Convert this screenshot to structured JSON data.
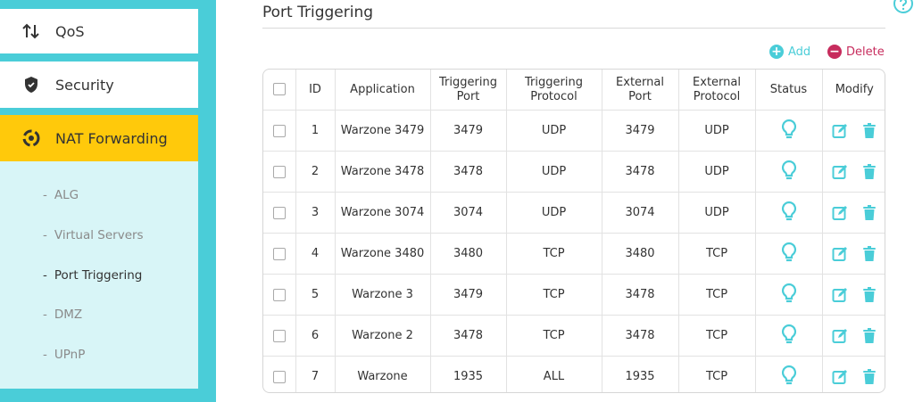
{
  "sidebar": {
    "items": [
      {
        "label": "QoS",
        "icon": "sort-arrows-icon"
      },
      {
        "label": "Security",
        "icon": "shield-icon"
      },
      {
        "label": "NAT Forwarding",
        "icon": "nat-icon"
      }
    ],
    "submenu": [
      {
        "label": "ALG",
        "active": false
      },
      {
        "label": "Virtual Servers",
        "active": false
      },
      {
        "label": "Port Triggering",
        "active": true
      },
      {
        "label": "DMZ",
        "active": false
      },
      {
        "label": "UPnP",
        "active": false
      }
    ],
    "dash": "-"
  },
  "page": {
    "title": "Port Triggering"
  },
  "toolbar": {
    "add_label": "Add",
    "delete_label": "Delete"
  },
  "table": {
    "headers": {
      "id": "ID",
      "application": "Application",
      "triggering_port": "Triggering Port",
      "triggering_protocol": "Triggering Protocol",
      "external_port": "External Port",
      "external_protocol": "External Protocol",
      "status": "Status",
      "modify": "Modify"
    },
    "rows": [
      {
        "id": "1",
        "application": "Warzone 3479",
        "triggering_port": "3479",
        "triggering_protocol": "UDP",
        "external_port": "3479",
        "external_protocol": "UDP"
      },
      {
        "id": "2",
        "application": "Warzone 3478",
        "triggering_port": "3478",
        "triggering_protocol": "UDP",
        "external_port": "3478",
        "external_protocol": "UDP"
      },
      {
        "id": "3",
        "application": "Warzone 3074",
        "triggering_port": "3074",
        "triggering_protocol": "UDP",
        "external_port": "3074",
        "external_protocol": "UDP"
      },
      {
        "id": "4",
        "application": "Warzone 3480",
        "triggering_port": "3480",
        "triggering_protocol": "TCP",
        "external_port": "3480",
        "external_protocol": "TCP"
      },
      {
        "id": "5",
        "application": "Warzone 3",
        "triggering_port": "3479",
        "triggering_protocol": "TCP",
        "external_port": "3478",
        "external_protocol": "TCP"
      },
      {
        "id": "6",
        "application": "Warzone 2",
        "triggering_port": "3478",
        "triggering_protocol": "TCP",
        "external_port": "3478",
        "external_protocol": "TCP"
      },
      {
        "id": "7",
        "application": "Warzone",
        "triggering_port": "1935",
        "triggering_protocol": "ALL",
        "external_port": "1935",
        "external_protocol": "TCP"
      }
    ]
  },
  "colors": {
    "accent": "#4acdd8",
    "active_menu": "#ffc90b",
    "danger": "#c72c5d",
    "submenu_bg": "#d8f5f7"
  }
}
